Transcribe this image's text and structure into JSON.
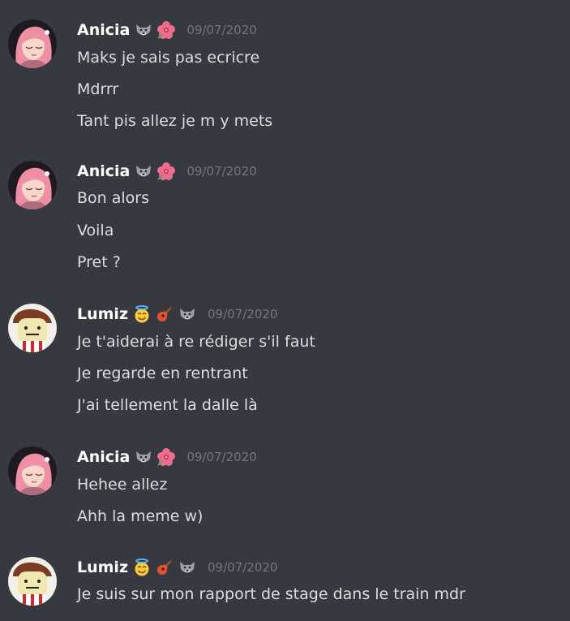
{
  "messages": [
    {
      "author": "Anicia",
      "badges": [
        "wolf-emoji",
        "hibiscus-emoji"
      ],
      "timestamp": "09/07/2020",
      "lines": [
        "Maks je sais pas ecricre",
        "Mdrrr",
        "Tant pis allez je m y mets"
      ]
    },
    {
      "author": "Anicia",
      "badges": [
        "wolf-emoji",
        "hibiscus-emoji"
      ],
      "timestamp": "09/07/2020",
      "lines": [
        "Bon alors",
        "Voila",
        "Pret ?"
      ]
    },
    {
      "author": "Lumiz",
      "badges": [
        "halo-smile-emoji",
        "guitar-emoji",
        "wolf-emoji"
      ],
      "timestamp": "09/07/2020",
      "lines": [
        "Je t'aiderai à re rédiger s'il faut",
        "Je regarde en rentrant",
        "J'ai tellement la dalle là"
      ]
    },
    {
      "author": "Anicia",
      "badges": [
        "wolf-emoji",
        "hibiscus-emoji"
      ],
      "timestamp": "09/07/2020",
      "lines": [
        "Hehee allez",
        "Ahh la meme w)"
      ]
    },
    {
      "author": "Lumiz",
      "badges": [
        "halo-smile-emoji",
        "guitar-emoji",
        "wolf-emoji"
      ],
      "timestamp": "09/07/2020",
      "lines": [
        "Je suis sur mon rapport de stage dans le train mdr"
      ]
    }
  ],
  "colors": {
    "background": "#36393f",
    "username": "#ffffff",
    "message_text": "#dcddde",
    "timestamp": "#72767d"
  }
}
